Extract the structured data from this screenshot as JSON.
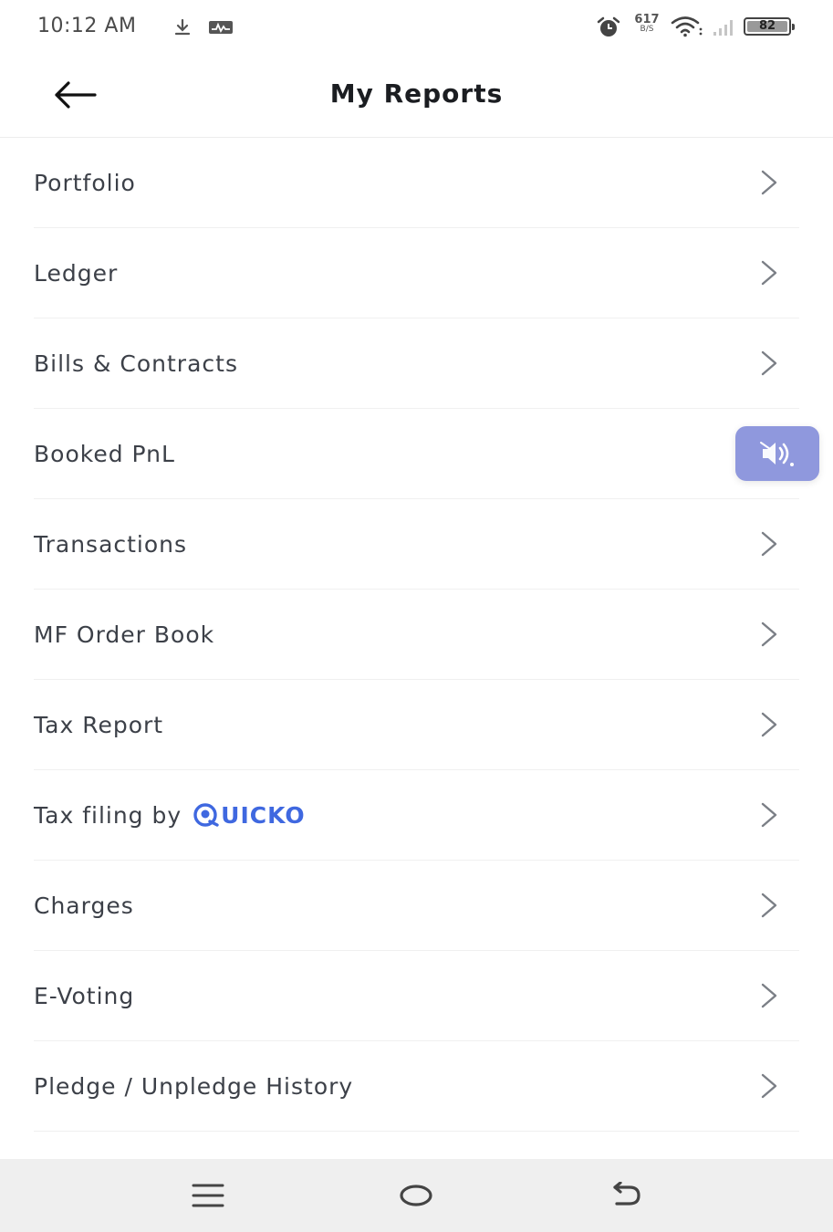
{
  "status_bar": {
    "time": "10:12 AM",
    "net_speed_value": "617",
    "net_speed_unit": "B/S",
    "battery": "82",
    "icons": [
      "download-icon",
      "activity-icon",
      "alarm-icon",
      "wifi-icon",
      "signal-icon",
      "battery-icon"
    ]
  },
  "header": {
    "title": "My Reports",
    "back_icon": "arrow-left-icon"
  },
  "menu": {
    "items": [
      {
        "label": "Portfolio"
      },
      {
        "label": "Ledger"
      },
      {
        "label": "Bills & Contracts"
      },
      {
        "label": "Booked PnL"
      },
      {
        "label": "Transactions"
      },
      {
        "label": "MF Order Book"
      },
      {
        "label": "Tax Report"
      },
      {
        "label": "Tax filing by",
        "brand": "UICKO"
      },
      {
        "label": "Charges"
      },
      {
        "label": "E-Voting"
      },
      {
        "label": "Pledge / Unpledge History"
      }
    ],
    "chevron_icon": "chevron-right-icon"
  },
  "floating_button": {
    "icon": "audio-accessibility-icon",
    "color": "#8f98dd"
  },
  "nav_bar": {
    "icons": [
      "menu-icon",
      "home-icon",
      "back-icon"
    ]
  },
  "colors": {
    "brand_blue": "#3f68e0",
    "text": "#3c4048",
    "title": "#1b1d21",
    "nav_bg": "#efefef"
  }
}
